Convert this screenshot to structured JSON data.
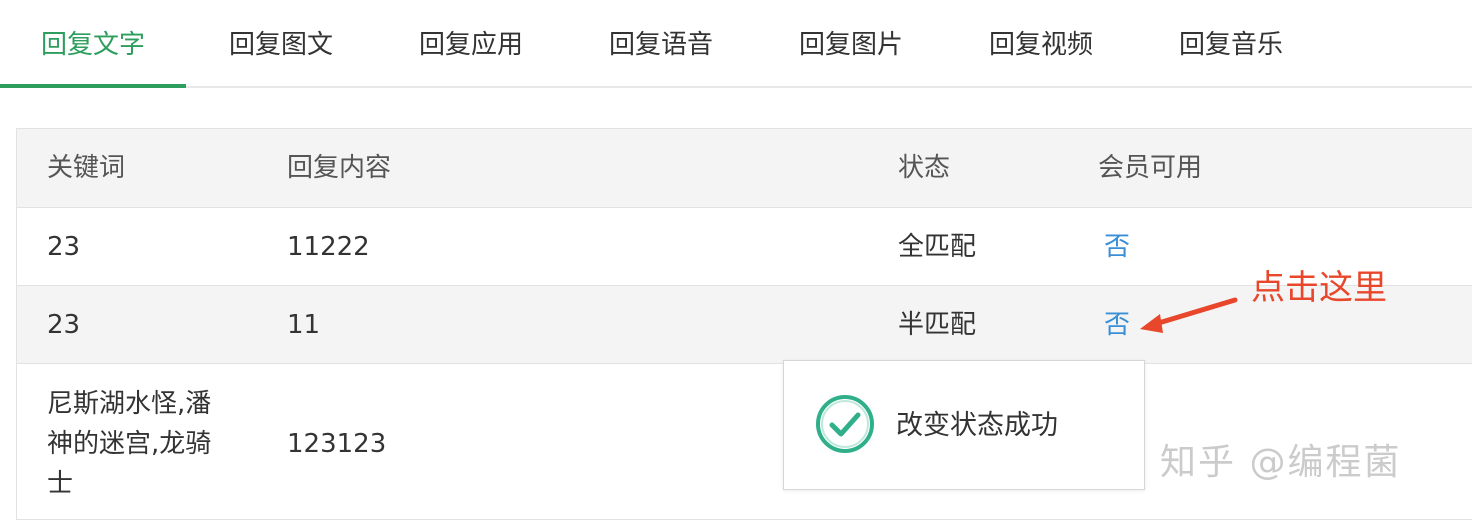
{
  "tabs": [
    {
      "label": "回复文字",
      "active": true
    },
    {
      "label": "回复图文",
      "active": false
    },
    {
      "label": "回复应用",
      "active": false
    },
    {
      "label": "回复语音",
      "active": false
    },
    {
      "label": "回复图片",
      "active": false
    },
    {
      "label": "回复视频",
      "active": false
    },
    {
      "label": "回复音乐",
      "active": false
    }
  ],
  "table": {
    "headers": [
      "关键词",
      "回复内容",
      "状态",
      "会员可用"
    ],
    "rows": [
      {
        "keyword": "23",
        "content": "11222",
        "status": "全匹配",
        "member": "否"
      },
      {
        "keyword": "23",
        "content": "11",
        "status": "半匹配",
        "member": "否"
      },
      {
        "keyword": "尼斯湖水怪,潘神的迷宫,龙骑士",
        "content": "123123",
        "status": "",
        "member": ""
      }
    ]
  },
  "toast": {
    "message": "改变状态成功",
    "icon": "check-circle-icon"
  },
  "annotation": {
    "text": "点击这里",
    "color": "#e8472b"
  },
  "watermark": {
    "text": "知乎 @编程菌"
  },
  "colors": {
    "accent": "#2e9e5e",
    "link": "#3a8fd6",
    "annotation": "#e8472b"
  }
}
